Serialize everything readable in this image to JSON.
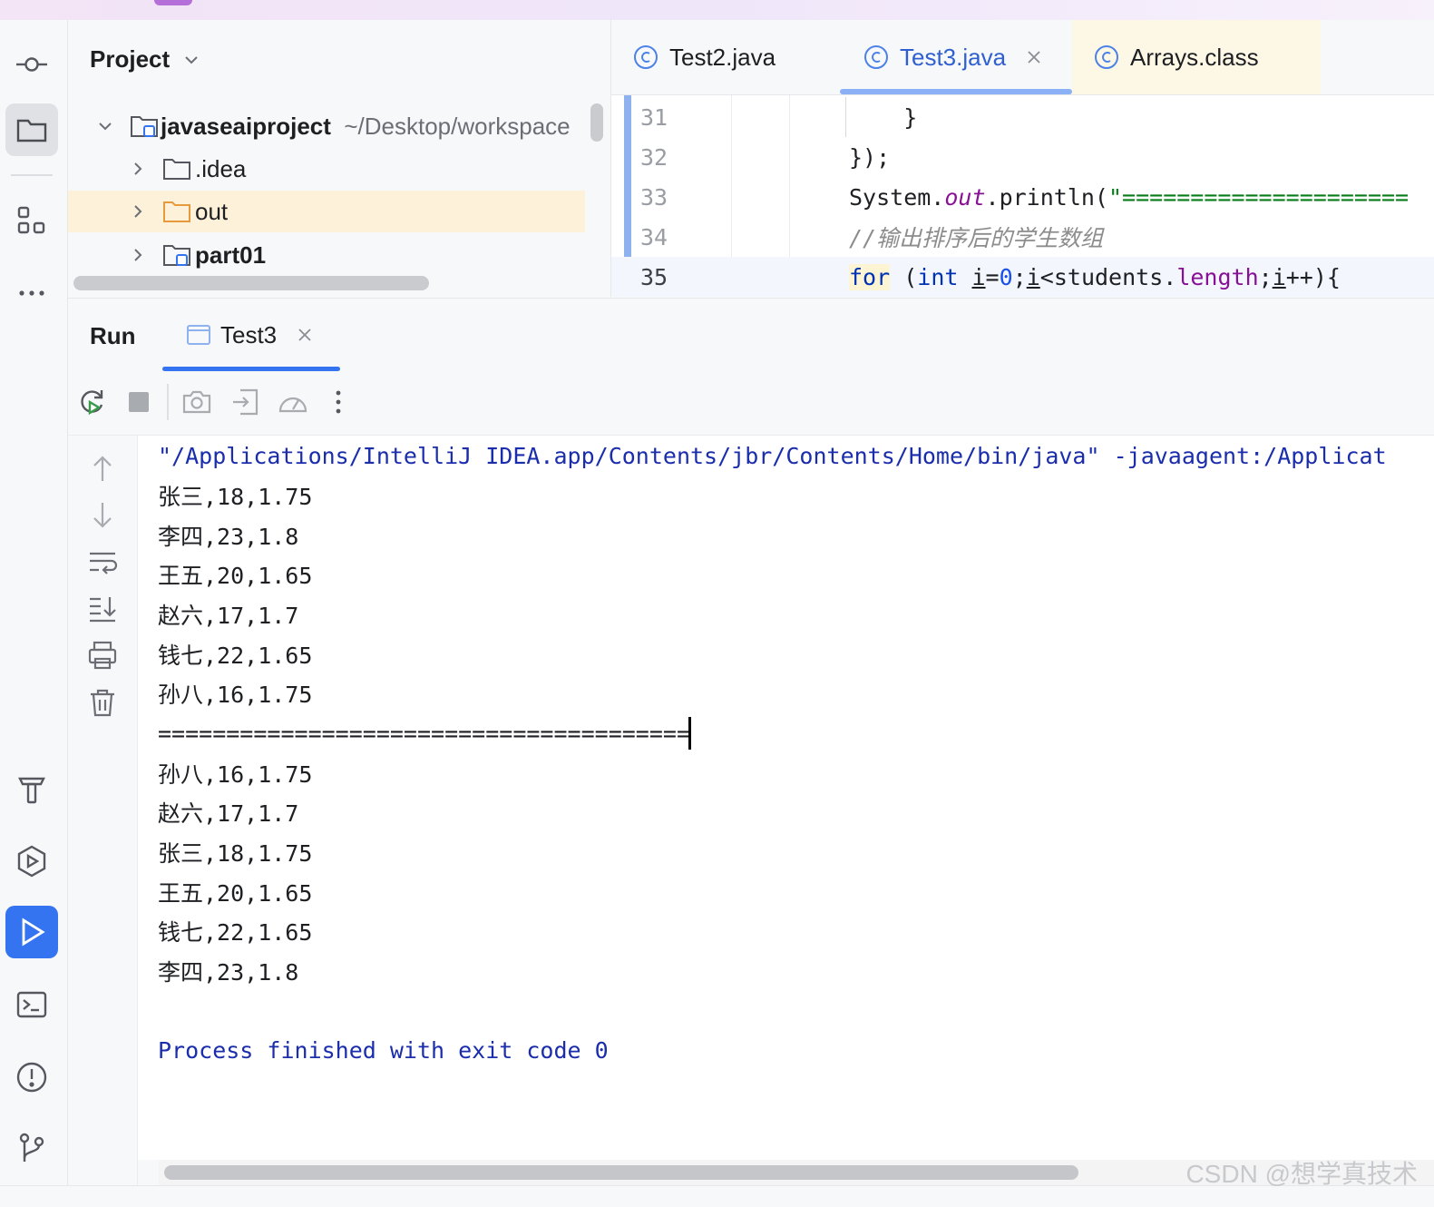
{
  "left_toolbar": {
    "icons": [
      "commit-icon",
      "project-folder-icon",
      "structure-icon",
      "more-icon",
      "build-hammer-icon",
      "services-icon",
      "run-icon",
      "terminal-icon",
      "problems-icon",
      "git-icon"
    ]
  },
  "project_panel": {
    "title": "Project",
    "tree": [
      {
        "name": "javaseaiproject",
        "path": "~/Desktop/workspace"
      },
      {
        "name": ".idea"
      },
      {
        "name": "out"
      },
      {
        "name": "part01"
      }
    ]
  },
  "editor": {
    "tabs": [
      {
        "label": "Test2.java"
      },
      {
        "label": "Test3.java"
      },
      {
        "label": "Arrays.class"
      }
    ],
    "lines": [
      {
        "num": "31",
        "text": "    }"
      },
      {
        "num": "32",
        "text": "});"
      },
      {
        "num": "33",
        "prefix": "System.",
        "field": "out",
        "mid": ".println(",
        "str": "\"====================="
      },
      {
        "num": "34",
        "comment": "//输出排序后的学生数组"
      },
      {
        "num": "35",
        "kw1": "for",
        "sp": " (",
        "kw2": "int",
        "sp2": " ",
        "v1": "i",
        "eq": "=",
        "n0": "0",
        "semi": ";",
        "v2": "i",
        "lt": "<students.",
        "mem": "length",
        "semi2": ";",
        "v3": "i",
        "end": "++){"
      }
    ]
  },
  "run_panel": {
    "title": "Run",
    "tab_label": "Test3",
    "console_lines": [
      "\"/Applications/IntelliJ IDEA.app/Contents/jbr/Contents/Home/bin/java\" -javaagent:/Applicat",
      "张三,18,1.75",
      "李四,23,1.8",
      "王五,20,1.65",
      "赵六,17,1.7",
      "钱七,22,1.65",
      "孙八,16,1.75",
      "=======================================",
      "孙八,16,1.75",
      "赵六,17,1.7",
      "张三,18,1.75",
      "王五,20,1.65",
      "钱七,22,1.65",
      "李四,23,1.8",
      "",
      "Process finished with exit code 0"
    ]
  },
  "watermark": "CSDN @想学真技术",
  "colors": {
    "accent": "#3574f0",
    "keyword": "#0033b3",
    "string": "#067d17",
    "field": "#871094",
    "console_blue": "#1a2dab"
  }
}
